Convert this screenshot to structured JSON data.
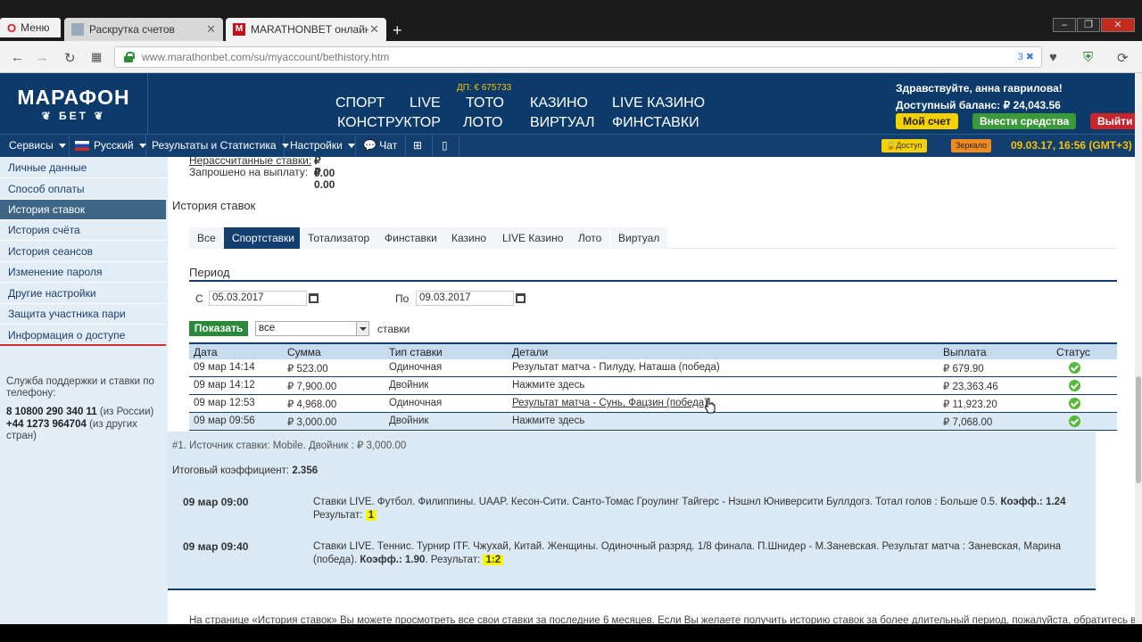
{
  "browser": {
    "menu_label": "Меню",
    "tabs": [
      {
        "title": "Раскрутка счетов"
      },
      {
        "title": "MARATHONBET онлайн б"
      }
    ],
    "new_tab": "+",
    "url": "www.marathonbet.com/su/myaccount/bethistory.htm",
    "ext_badge": "3"
  },
  "header": {
    "logo_main": "МАРАФОН",
    "logo_sub": "БЕТ",
    "dp": "ДП: € 675733",
    "nav": [
      "СПОРТ",
      "LIVE",
      "ТОТО",
      "КАЗИНО",
      "LIVE КАЗИНО",
      "КОНСТРУКТОР",
      "ЛОТО",
      "ВИРТУАЛ",
      "ФИНСТАВКИ"
    ],
    "greeting": "Здравствуйте, анна гаврилова!",
    "balance": "Доступный баланс: ₽ 24,043.56",
    "my_account": "Мой счет",
    "deposit": "Внести средства",
    "logout": "Выйти"
  },
  "toolbar": {
    "services": "Сервисы",
    "language": "Русский",
    "results": "Результаты и Статистика",
    "settings": "Настройки",
    "chat": "Чат",
    "access": "Доступ",
    "mirror": "Зеркало",
    "datetime": "09.03.17, 16:56 (GMT+3)"
  },
  "sidebar": {
    "items": [
      {
        "label": "Личные данные"
      },
      {
        "label": "Способ оплаты"
      },
      {
        "label": "История ставок"
      },
      {
        "label": "История счёта"
      },
      {
        "label": "История сеансов"
      },
      {
        "label": "Изменение пароля"
      },
      {
        "label": "Другие настройки"
      },
      {
        "label": "Защита участника пари"
      },
      {
        "label": "Информация о доступе"
      }
    ],
    "support_text": "Служба поддержки и ставки по телефону:",
    "phone1": "8 10800 290 340 11",
    "phone1_note": "(из России)",
    "phone2": "+44 1273 964704",
    "phone2_note": "(из других стран)"
  },
  "summary": {
    "unsettled_label": "Нерассчитанные ставки:",
    "unsettled_value": "₽ 0.00",
    "withdraw_label": "Запрошено на выплату:",
    "withdraw_value": "₽ 0.00"
  },
  "page_title": "История ставок",
  "filter_tabs": [
    "Все",
    "Спортставки",
    "Тотализатор",
    "Финставки",
    "Казино",
    "LIVE Казино",
    "Лото",
    "Виртуал"
  ],
  "period": {
    "label": "Период",
    "from_label": "С",
    "from_value": "05.03.2017",
    "to_label": "По",
    "to_value": "09.03.2017",
    "show_button": "Показать",
    "select_value": "все",
    "stakes_label": "ставки"
  },
  "table": {
    "headers": [
      "Дата",
      "Сумма",
      "Тип ставки",
      "Детали",
      "Выплата",
      "Статус"
    ],
    "rows": [
      {
        "date": "09 мар 14:14",
        "amount": "₽ 523.00",
        "type": "Одиночная",
        "details": "Результат матча - Пилуду, Наташа (победа)",
        "payout": "₽ 679.90"
      },
      {
        "date": "09 мар 14:12",
        "amount": "₽ 7,900.00",
        "type": "Двойник",
        "details": "Нажмите здесь",
        "payout": "₽ 23,363.46"
      },
      {
        "date": "09 мар 12:53",
        "amount": "₽ 4,968.00",
        "type": "Одиночная",
        "details": "Результат матча - Сунь, Фацзин (победа)",
        "payout": "₽ 11,923.20"
      },
      {
        "date": "09 мар 09:56",
        "amount": "₽ 3,000.00",
        "type": "Двойник",
        "details": "Нажмите здесь",
        "payout": "₽ 7,068.00"
      }
    ]
  },
  "detail": {
    "source": "#1. Источник ставки: Mobile. Двойник : ₽ 3,000.00",
    "total_coeff_label": "Итоговый коэффициент:",
    "total_coeff_value": "2.356",
    "legs": [
      {
        "time": "09 мар 09:00",
        "text": "Ставки LIVE. Футбол. Филиппины. UAAP. Кесон-Сити. Санто-Томас Гроулинг Тайгерс - Нэшнл Юниверсити Буллдогз. Тотал голов : Больше 0.5.",
        "coeff_label": "Коэфф.:",
        "coeff": "1.24",
        "result_label": "Результат:",
        "result": "1"
      },
      {
        "time": "09 мар 09:40",
        "text": "Ставки LIVE. Теннис. Турнир ITF. Чжухай, Китай. Женщины. Одиночный разряд. 1/8 финала. П.Шнидер - М.Заневская. Результат матча : Заневская, Марина (победа).",
        "coeff_label": "Коэфф.:",
        "coeff": "1.90",
        "result_label": "Результат:",
        "result": "1:2"
      }
    ]
  },
  "footer_note": "На странице «История ставок» Вы можете просмотреть все свои ставки за последние 6 месяцев. Если Вы желаете получить историю ставок за более длительный период, пожалуйста, обратитесь в"
}
